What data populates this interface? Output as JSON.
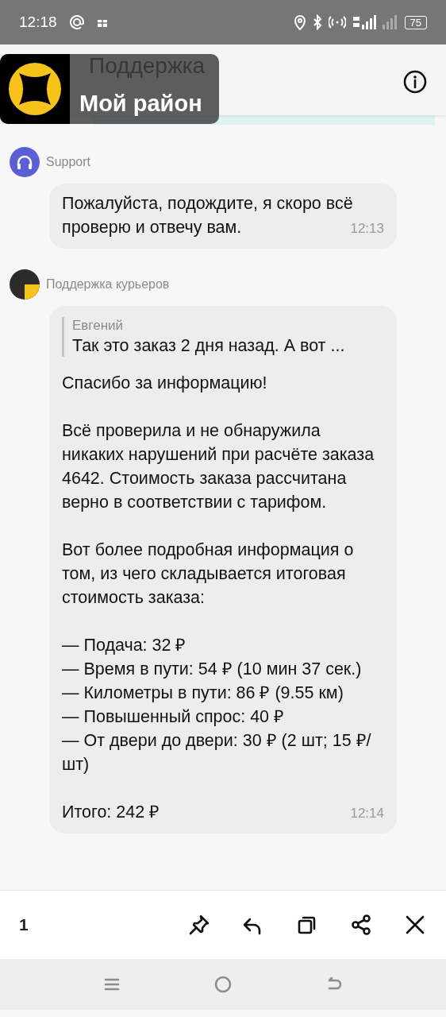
{
  "status_bar": {
    "time": "12:18",
    "battery": "75"
  },
  "header": {
    "title": "Поддержка"
  },
  "overlay": {
    "label": "Мой район"
  },
  "messages": [
    {
      "kind": "support",
      "sender": "Support",
      "paragraphs": [
        "Пожалуйста, подождите, я скоро всё проверю и отвечу вам."
      ],
      "time": "12:13"
    },
    {
      "kind": "courier",
      "sender": "Поддержка курьеров",
      "quote": {
        "author": "Евгений",
        "text": "Так это заказ 2 дня назад. А вот ..."
      },
      "paragraphs": [
        "Спасибо за информацию!",
        "Всё проверила и не обнаружила никаких нарушений при расчёте заказа 4642. Стоимость заказа рассчитана верно в соответствии с тарифом.",
        "Вот более подробная информация о том, из чего складывается итоговая стоимость заказа:",
        [
          "— Подача: 32 ₽",
          "— Время в пути: 54 ₽ (10 мин 37 сек.)",
          "— Километры в пути: 86 ₽ (9.55 км)",
          "— Повышенный спрос: 40 ₽",
          "— От двери до двери: 30 ₽ (2 шт; 15 ₽/шт)"
        ],
        "Итого: 242 ₽"
      ],
      "time": "12:14"
    }
  ],
  "action_bar": {
    "count": "1"
  }
}
